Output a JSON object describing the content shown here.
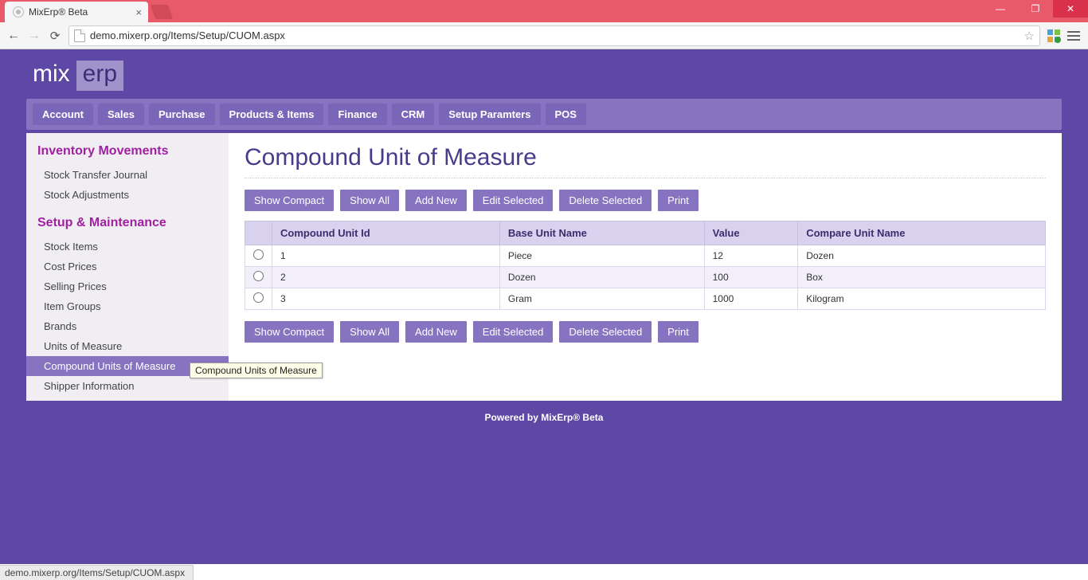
{
  "browser": {
    "tab_title": "MixErp® Beta",
    "url": "demo.mixerp.org/Items/Setup/CUOM.aspx",
    "status_text": "demo.mixerp.org/Items/Setup/CUOM.aspx"
  },
  "logo": {
    "part1": "mix",
    "part2": "erp"
  },
  "topnav": [
    "Account",
    "Sales",
    "Purchase",
    "Products & Items",
    "Finance",
    "CRM",
    "Setup Paramters",
    "POS"
  ],
  "sidebar": {
    "groups": [
      {
        "heading": "Inventory Movements",
        "items": [
          {
            "label": "Stock Transfer Journal",
            "active": false
          },
          {
            "label": "Stock Adjustments",
            "active": false
          }
        ]
      },
      {
        "heading": "Setup & Maintenance",
        "items": [
          {
            "label": "Stock Items",
            "active": false
          },
          {
            "label": "Cost Prices",
            "active": false
          },
          {
            "label": "Selling Prices",
            "active": false
          },
          {
            "label": "Item Groups",
            "active": false
          },
          {
            "label": "Brands",
            "active": false
          },
          {
            "label": "Units of Measure",
            "active": false
          },
          {
            "label": "Compound Units of Measure",
            "active": true
          },
          {
            "label": "Shipper Information",
            "active": false
          }
        ]
      }
    ]
  },
  "page": {
    "title": "Compound Unit of Measure",
    "buttons": [
      "Show Compact",
      "Show All",
      "Add New",
      "Edit Selected",
      "Delete Selected",
      "Print"
    ]
  },
  "table": {
    "headers": [
      "Compound Unit Id",
      "Base Unit Name",
      "Value",
      "Compare Unit Name"
    ],
    "rows": [
      {
        "id": "1",
        "base": "Piece",
        "value": "12",
        "compare": "Dozen"
      },
      {
        "id": "2",
        "base": "Dozen",
        "value": "100",
        "compare": "Box"
      },
      {
        "id": "3",
        "base": "Gram",
        "value": "1000",
        "compare": "Kilogram"
      }
    ]
  },
  "tooltip": "Compound Units of Measure",
  "footer": "Powered by MixErp® Beta"
}
